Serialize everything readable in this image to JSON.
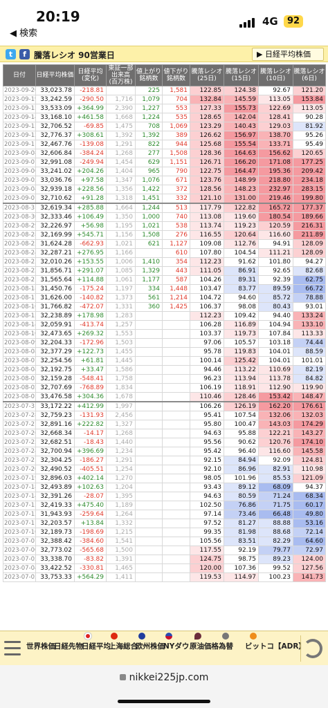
{
  "status_bar": {
    "time": "20:19",
    "back_label": "◀ 検索",
    "network": "4G",
    "battery": "92"
  },
  "title_bar": {
    "title": "騰落レシオ 90営業日",
    "nav_button": "日経平均株価",
    "twitter_icon": "t",
    "facebook_icon": "f"
  },
  "table": {
    "headers": [
      "日付",
      "日経平均株価",
      "日経平均\n(変化)",
      "東証一部\n出来高\n(百万株)",
      "値上がり\n銘柄数",
      "値下がり\n銘柄数",
      "騰落レシオ\n(25日)",
      "騰落レシオ\n(15日)",
      "騰落レシオ\n(10日)",
      "騰落レシオ\n(6日)"
    ],
    "rows": [
      [
        "2023-09-20",
        "33,023.78",
        "-218.81",
        "",
        "225",
        "1,581",
        "122.85",
        "124.38",
        "92.67",
        "121.20"
      ],
      [
        "2023-09-19",
        "33,242.59",
        "-290.50",
        "1,716",
        "1,079",
        "704",
        "132.84",
        "145.59",
        "113.05",
        "153.84"
      ],
      [
        "2023-09-15",
        "33,533.09",
        "+364.99",
        "2,390",
        "1,227",
        "553",
        "127.33",
        "155.73",
        "122.69",
        "113.05"
      ],
      [
        "2023-09-14",
        "33,168.10",
        "+461.58",
        "1,668",
        "1,224",
        "535",
        "128.65",
        "142.04",
        "128.41",
        "90.28"
      ],
      [
        "2023-09-13",
        "32,706.52",
        "-69.85",
        "1,475",
        "708",
        "1,069",
        "123.29",
        "140.43",
        "129.03",
        "81.92"
      ],
      [
        "2023-09-12",
        "32,776.37",
        "+308.61",
        "1,392",
        "1,392",
        "389",
        "126.62",
        "156.97",
        "138.70",
        "95.26"
      ],
      [
        "2023-09-11",
        "32,467.76",
        "-139.08",
        "1,291",
        "822",
        "944",
        "125.68",
        "155.54",
        "133.71",
        "95.49"
      ],
      [
        "2023-09-08",
        "32,606.84",
        "-384.24",
        "1,268",
        "277",
        "1,508",
        "128.36",
        "164.63",
        "156.62",
        "120.65"
      ],
      [
        "2023-09-07",
        "32,991.08",
        "-249.94",
        "1,454",
        "629",
        "1,151",
        "126.71",
        "166.20",
        "171.08",
        "177.25"
      ],
      [
        "2023-09-06",
        "33,241.02",
        "+204.26",
        "1,404",
        "965",
        "790",
        "122.75",
        "164.47",
        "195.36",
        "209.42"
      ],
      [
        "2023-09-05",
        "33,036.76",
        "+97.58",
        "1,347",
        "1,076",
        "671",
        "123.76",
        "148.99",
        "218.80",
        "234.18"
      ],
      [
        "2023-09-04",
        "32,939.18",
        "+228.56",
        "1,356",
        "1,422",
        "372",
        "128.56",
        "148.23",
        "232.97",
        "283.15"
      ],
      [
        "2023-09-01",
        "32,710.62",
        "+91.28",
        "1,318",
        "1,451",
        "332",
        "121.10",
        "131.00",
        "219.46",
        "199.80"
      ],
      [
        "2023-08-31",
        "32,619.34",
        "+285.88",
        "1,664",
        "1,244",
        "513",
        "117.79",
        "122.82",
        "165.72",
        "177.37"
      ],
      [
        "2023-08-30",
        "32,333.46",
        "+106.49",
        "1,350",
        "1,000",
        "740",
        "113.08",
        "119.60",
        "180.54",
        "189.66"
      ],
      [
        "2023-08-29",
        "32,226.97",
        "+56.98",
        "1,195",
        "1,021",
        "538",
        "113.74",
        "119.23",
        "120.59",
        "216.31"
      ],
      [
        "2023-08-28",
        "32,169.99",
        "+545.71",
        "1,156",
        "1,508",
        "276",
        "116.55",
        "120.64",
        "116.60",
        "211.89"
      ],
      [
        "2023-08-25",
        "31,624.28",
        "-662.93",
        "1,021",
        "621",
        "1,127",
        "109.08",
        "112.76",
        "94.91",
        "128.09"
      ],
      [
        "2023-08-24",
        "32,287.21",
        "+276.95",
        "1,166",
        "",
        "610",
        "107.80",
        "104.54",
        "111.21",
        "128.09"
      ],
      [
        "2023-08-23",
        "32,010.26",
        "+153.55",
        "1,006",
        "1,410",
        "354",
        "112.23",
        "91.62",
        "101.80",
        "94.27"
      ],
      [
        "2023-08-22",
        "31,856.71",
        "+291.07",
        "1,085",
        "1,329",
        "443",
        "111.05",
        "86.91",
        "92.65",
        "82.68"
      ],
      [
        "2023-08-21",
        "31,565.64",
        "+114.88",
        "1,061",
        "1,177",
        "587",
        "104.26",
        "89.31",
        "92.39",
        "62.75"
      ],
      [
        "2023-08-18",
        "31,450.76",
        "-175.24",
        "1,197",
        "334",
        "1,448",
        "103.47",
        "83.77",
        "89.59",
        "66.72"
      ],
      [
        "2023-08-17",
        "31,626.00",
        "-140.82",
        "1,373",
        "561",
        "1,214",
        "104.72",
        "94.60",
        "85.72",
        "78.88"
      ],
      [
        "2023-08-16",
        "31,766.82",
        "-472.07",
        "1,331",
        "360",
        "1,425",
        "106.37",
        "98.08",
        "80.43",
        "93.01"
      ],
      [
        "2023-08-15",
        "32,238.89",
        "+178.98",
        "1,283",
        "",
        "",
        "112.23",
        "109.42",
        "94.40",
        "133.24"
      ],
      [
        "2023-08-14",
        "32,059.91",
        "-413.74",
        "1,257",
        "",
        "",
        "106.28",
        "116.89",
        "104.94",
        "133.10"
      ],
      [
        "2023-08-10",
        "32,473.65",
        "+269.32",
        "1,553",
        "",
        "",
        "103.37",
        "119.73",
        "107.84",
        "113.33"
      ],
      [
        "2023-08-09",
        "32,204.33",
        "-172.96",
        "1,503",
        "",
        "",
        "97.06",
        "105.57",
        "103.18",
        "74.44"
      ],
      [
        "2023-08-08",
        "32,377.29",
        "+122.73",
        "1,455",
        "",
        "",
        "95.78",
        "119.83",
        "104.01",
        "88.59"
      ],
      [
        "2023-08-07",
        "32,254.56",
        "+61.81",
        "1,445",
        "",
        "",
        "100.14",
        "125.42",
        "104.01",
        "101.01"
      ],
      [
        "2023-08-04",
        "32,192.75",
        "+33.47",
        "1,586",
        "",
        "",
        "94.46",
        "113.22",
        "110.69",
        "82.19"
      ],
      [
        "2023-08-03",
        "32,159.28",
        "-548.41",
        "1,758",
        "",
        "",
        "96.23",
        "113.94",
        "113.78",
        "84.82"
      ],
      [
        "2023-08-02",
        "32,707.69",
        "-768.89",
        "1,834",
        "",
        "",
        "106.19",
        "118.91",
        "112.90",
        "119.90"
      ],
      [
        "2023-08-01",
        "33,476.58",
        "+304.36",
        "1,678",
        "",
        "",
        "110.46",
        "128.46",
        "153.42",
        "148.47"
      ],
      [
        "2023-07-31",
        "33,172.22",
        "+412.99",
        "1,997",
        "",
        "",
        "106.26",
        "126.19",
        "162.20",
        "176.61"
      ],
      [
        "2023-07-28",
        "32,759.23",
        "-131.93",
        "2,456",
        "",
        "",
        "95.41",
        "107.54",
        "132.06",
        "132.03"
      ],
      [
        "2023-07-27",
        "32,891.16",
        "+222.82",
        "1,327",
        "",
        "",
        "95.80",
        "100.47",
        "143.03",
        "174.29"
      ],
      [
        "2023-07-26",
        "32,668.34",
        "-14.17",
        "1,268",
        "",
        "",
        "94.63",
        "95.88",
        "122.21",
        "143.27"
      ],
      [
        "2023-07-25",
        "32,682.51",
        "-18.43",
        "1,440",
        "",
        "",
        "95.56",
        "90.62",
        "120.76",
        "174.10"
      ],
      [
        "2023-07-24",
        "32,700.94",
        "+396.69",
        "1,234",
        "",
        "",
        "95.42",
        "96.40",
        "116.60",
        "145.58"
      ],
      [
        "2023-07-21",
        "32,304.25",
        "-186.27",
        "1,291",
        "",
        "",
        "92.15",
        "84.94",
        "92.09",
        "124.81"
      ],
      [
        "2023-07-20",
        "32,490.52",
        "-405.51",
        "1,254",
        "",
        "",
        "92.10",
        "86.96",
        "82.91",
        "110.98"
      ],
      [
        "2023-07-19",
        "32,896.03",
        "+402.14",
        "1,270",
        "",
        "",
        "98.05",
        "101.96",
        "85.53",
        "121.09"
      ],
      [
        "2023-07-18",
        "32,493.89",
        "+102.63",
        "1,204",
        "",
        "",
        "93.43",
        "89.12",
        "68.09",
        "94.37"
      ],
      [
        "2023-07-14",
        "32,391.26",
        "-28.07",
        "1,395",
        "",
        "",
        "94.63",
        "80.59",
        "71.24",
        "68.34"
      ],
      [
        "2023-07-13",
        "32,419.33",
        "+475.40",
        "1,189",
        "",
        "",
        "102.50",
        "76.86",
        "71.75",
        "60.17"
      ],
      [
        "2023-07-12",
        "31,943.93",
        "-259.64",
        "1,264",
        "",
        "",
        "97.14",
        "73.46",
        "66.48",
        "49.80"
      ],
      [
        "2023-07-11",
        "32,203.57",
        "+13.84",
        "1,332",
        "",
        "",
        "97.52",
        "81.27",
        "88.88",
        "53.16"
      ],
      [
        "2023-07-10",
        "32,189.73",
        "-198.69",
        "1,215",
        "",
        "",
        "99.35",
        "81.98",
        "88.68",
        "72.14"
      ],
      [
        "2023-07-07",
        "32,388.42",
        "-384.60",
        "1,541",
        "",
        "",
        "105.56",
        "83.51",
        "82.29",
        "64.60"
      ],
      [
        "2023-07-06",
        "32,773.02",
        "-565.68",
        "1,500",
        "",
        "",
        "117.55",
        "92.19",
        "79.77",
        "72.97"
      ],
      [
        "2023-07-05",
        "33,338.70",
        "-83.82",
        "1,391",
        "",
        "",
        "124.75",
        "98.75",
        "89.23",
        "124.00"
      ],
      [
        "2023-07-04",
        "33,422.52",
        "-330.81",
        "1,465",
        "",
        "",
        "120.00",
        "107.36",
        "99.52",
        "127.56"
      ],
      [
        "2023-07-03",
        "33,753.33",
        "+564.29",
        "1,411",
        "",
        "",
        "119.53",
        "114.97",
        "100.23",
        "141.73"
      ]
    ]
  },
  "toolbar": {
    "items": [
      "世界株価",
      "日経先物",
      "日経平均",
      "上海総合",
      "欧州株価",
      "NYダウ",
      "原油価格",
      "為替",
      "ビットコ",
      "【ADR】"
    ],
    "menu_icon": "hamburger-menu-icon",
    "refresh_icon": "refresh-icon"
  },
  "url_bar": {
    "url": "nikkei225jp.com"
  },
  "colors": {
    "header_bg": "#6f6e6e",
    "title_bg": "#fdf1a9",
    "positive": "#2e8b2e",
    "negative": "#e0392b",
    "red_heat": "#f8a6aa",
    "blue_heat": "#b8c6f3"
  }
}
